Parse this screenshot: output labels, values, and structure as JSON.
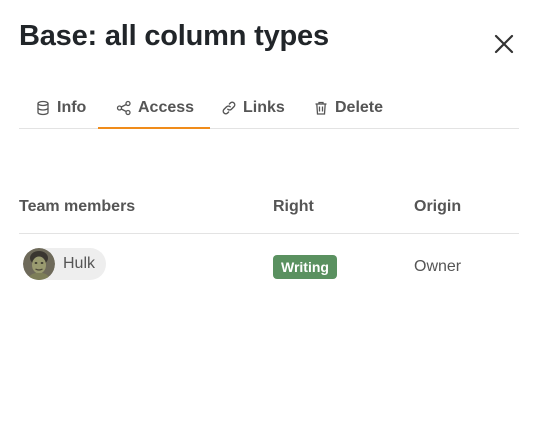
{
  "dialog": {
    "title": "Base: all column types",
    "close_icon": "close-icon"
  },
  "tabs": [
    {
      "label": "Info",
      "icon": "database-icon",
      "active": false
    },
    {
      "label": "Access",
      "icon": "share-icon",
      "active": true
    },
    {
      "label": "Links",
      "icon": "link-icon",
      "active": false
    },
    {
      "label": "Delete",
      "icon": "trash-icon",
      "active": false
    }
  ],
  "table": {
    "headers": [
      "Team members",
      "Right",
      "Origin"
    ],
    "rows": [
      {
        "member": "Hulk",
        "avatar": "user-avatar",
        "right": "Writing",
        "origin": "Owner"
      }
    ]
  },
  "colors": {
    "accent": "#f08c1a",
    "badge_green": "#5a9160",
    "text": "#555555"
  }
}
